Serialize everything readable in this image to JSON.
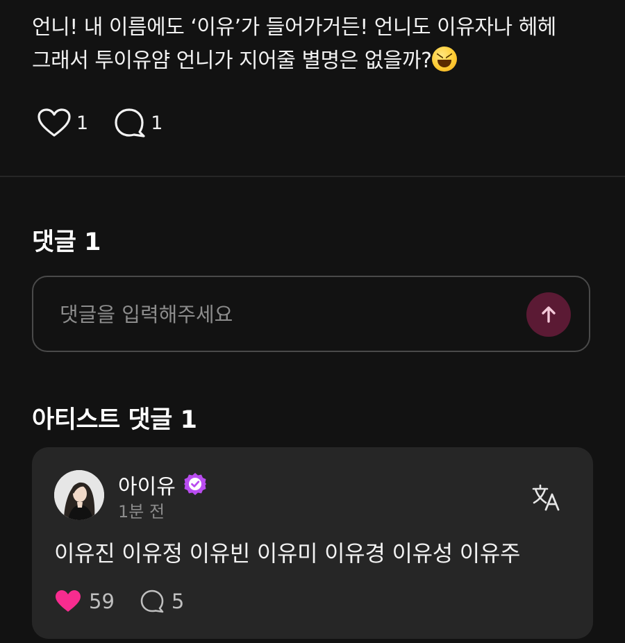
{
  "post": {
    "text_line1": "언니! 내 이름에도 ‘이유’가 들어가거든! 언니도 이유자나 헤헤",
    "text_line2": "그래서 투이유얌 언니가 지어줄 별명은 없을까?",
    "emoji": "grinning-squinting-face-emoji",
    "like_count": "1",
    "comment_count": "1"
  },
  "comments_section": {
    "title": "댓글 1",
    "input_placeholder": "댓글을 입력해주세요",
    "send_icon": "arrow-up-icon"
  },
  "artist_section": {
    "title": "아티스트 댓글 1",
    "comment": {
      "author": "아이유",
      "verified_icon": "verified-badge-icon",
      "time": "1분 전",
      "text": "이유진 이유정 이유빈 이유미 이유경 이유성 이유주",
      "like_count": "59",
      "reply_count": "5",
      "translate_icon": "translate-icon"
    }
  },
  "colors": {
    "background": "#121212",
    "card": "#262626",
    "accent_pink": "#f72c8f",
    "badge_purple": "#b94cf0",
    "send_button": "#5b1a34"
  }
}
